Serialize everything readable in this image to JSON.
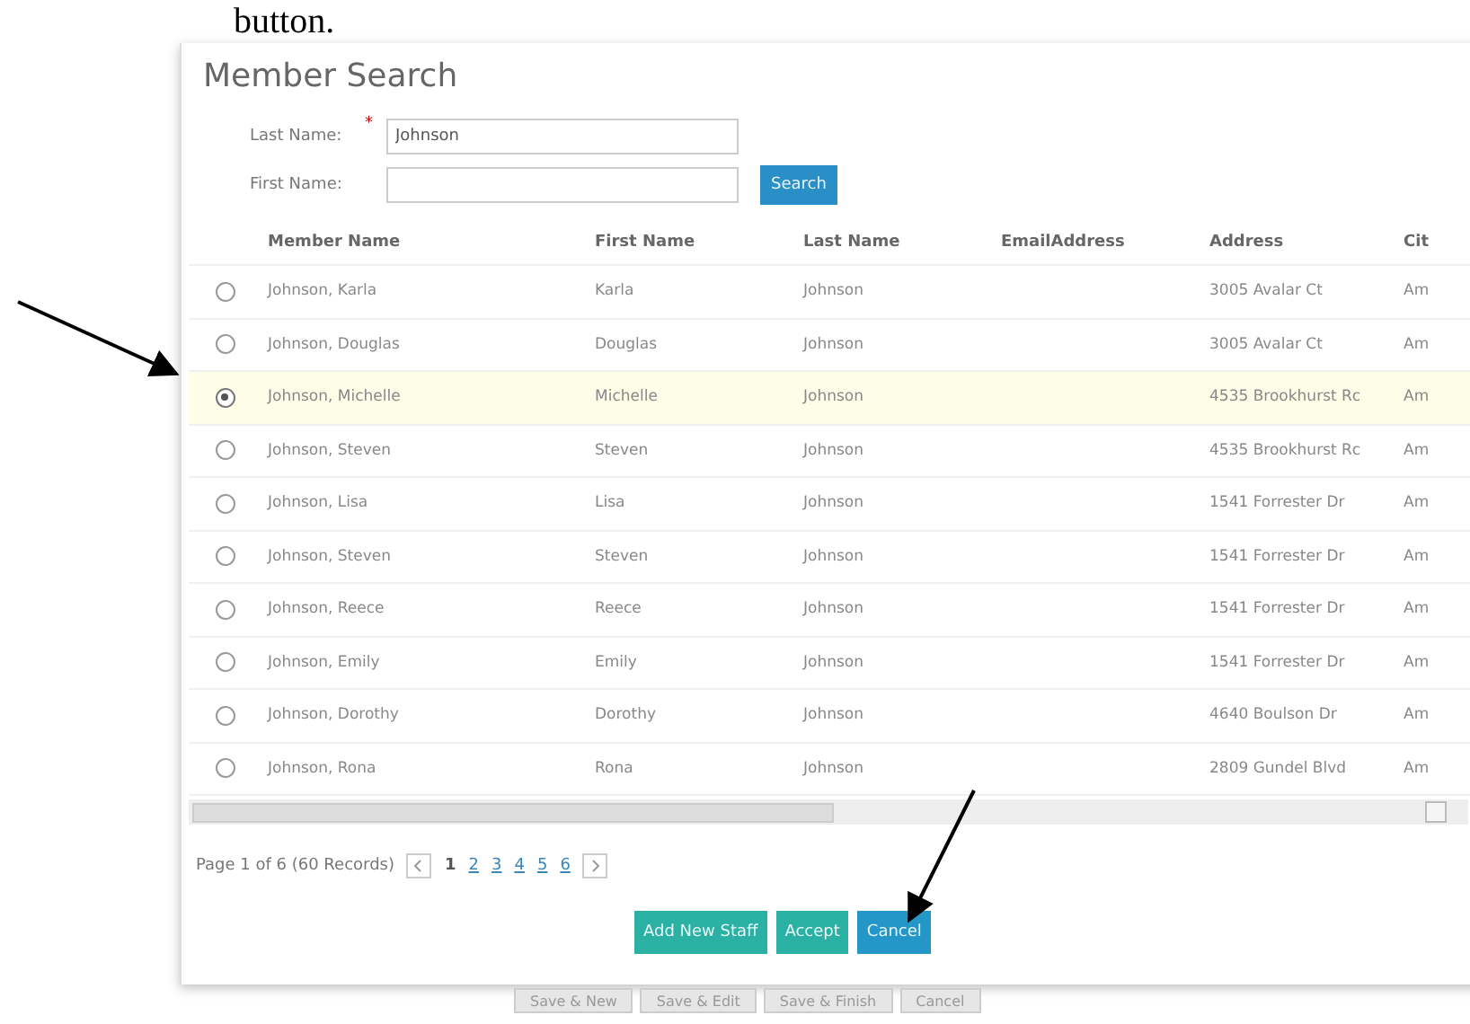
{
  "document_text": "button.",
  "dialog": {
    "title": "Member Search",
    "fields": [
      {
        "label": "Last Name:",
        "marker": "*",
        "value": "Johnson"
      },
      {
        "label": "First Name:"
      }
    ],
    "search_button": "Search",
    "table": {
      "columns": [
        "Member Name",
        "First Name",
        "Last Name",
        "EmailAddress",
        "Address",
        "Cit"
      ],
      "rows": [
        {
          "selected": false,
          "cells": [
            "Johnson, Karla",
            "Karla",
            "Johnson",
            "",
            "3005 Avalar Ct",
            "Am"
          ]
        },
        {
          "selected": false,
          "cells": [
            "Johnson, Douglas",
            "Douglas",
            "Johnson",
            "",
            "3005 Avalar Ct",
            "Am"
          ]
        },
        {
          "selected": true,
          "cells": [
            "Johnson, Michelle",
            "Michelle",
            "Johnson",
            "",
            "4535 Brookhurst Rc",
            "Am"
          ]
        },
        {
          "selected": false,
          "cells": [
            "Johnson, Steven",
            "Steven",
            "Johnson",
            "",
            "4535 Brookhurst Rc",
            "Am"
          ]
        },
        {
          "selected": false,
          "cells": [
            "Johnson, Lisa",
            "Lisa",
            "Johnson",
            "",
            "1541 Forrester Dr",
            "Am"
          ]
        },
        {
          "selected": false,
          "cells": [
            "Johnson, Steven",
            "Steven",
            "Johnson",
            "",
            "1541 Forrester Dr",
            "Am"
          ]
        },
        {
          "selected": false,
          "cells": [
            "Johnson, Reece",
            "Reece",
            "Johnson",
            "",
            "1541 Forrester Dr",
            "Am"
          ]
        },
        {
          "selected": false,
          "cells": [
            "Johnson, Emily",
            "Emily",
            "Johnson",
            "",
            "1541 Forrester Dr",
            "Am"
          ]
        },
        {
          "selected": false,
          "cells": [
            "Johnson, Dorothy",
            "Dorothy",
            "Johnson",
            "",
            "4640 Boulson Dr",
            "Am"
          ]
        },
        {
          "selected": false,
          "cells": [
            "Johnson, Rona",
            "Rona",
            "Johnson",
            "",
            "2809 Gundel Blvd",
            "Am"
          ]
        }
      ]
    },
    "pager": {
      "summary": "Page 1 of 6 (60 Records)",
      "pages": [
        {
          "label": "1",
          "selected": true
        },
        {
          "label": "2",
          "selected": false
        },
        {
          "label": "3",
          "selected": false
        },
        {
          "label": "4",
          "selected": false
        },
        {
          "label": "5",
          "selected": false
        },
        {
          "label": "6",
          "selected": false
        }
      ]
    },
    "buttons": [
      {
        "label": "Add New Staff",
        "kind": "teal"
      },
      {
        "label": "Accept",
        "kind": "teal"
      },
      {
        "label": "Cancel",
        "kind": "blue"
      }
    ]
  },
  "background_buttons": [
    "Save & New",
    "Save & Edit",
    "Save & Finish",
    "Cancel"
  ]
}
